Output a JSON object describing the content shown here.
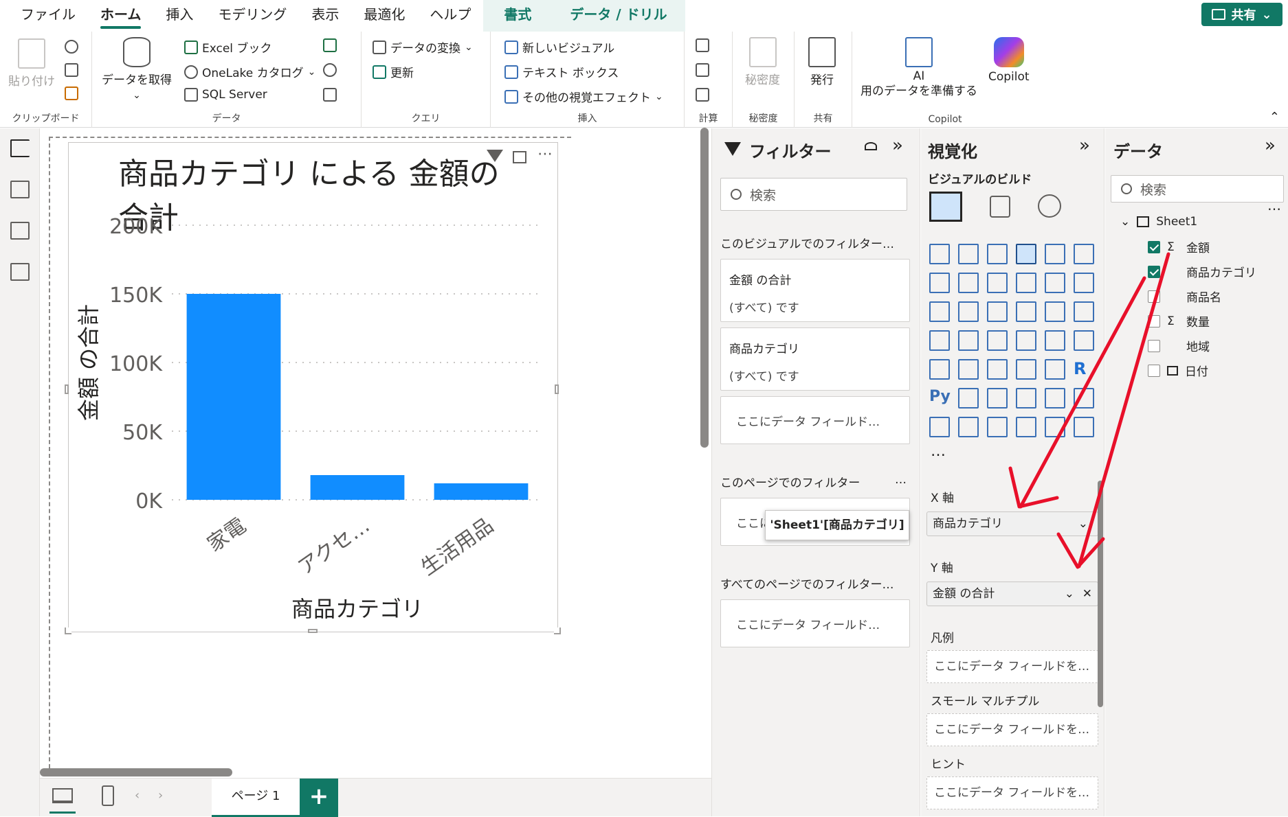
{
  "menubar": {
    "tabs": [
      "ファイル",
      "ホーム",
      "挿入",
      "モデリング",
      "表示",
      "最適化",
      "ヘルプ",
      "書式",
      "データ / ドリル"
    ],
    "active": "ホーム",
    "share": "共有"
  },
  "ribbon": {
    "clipboard": {
      "label": "クリップボード",
      "paste": "貼り付け"
    },
    "data": {
      "label": "データ",
      "get_data": "データを取得",
      "excel": "Excel ブック",
      "onelake": "OneLake カタログ",
      "sql": "SQL Server"
    },
    "query": {
      "label": "クエリ",
      "transform": "データの変換",
      "refresh": "更新"
    },
    "insert": {
      "label": "挿入",
      "new_visual": "新しいビジュアル",
      "text_box": "テキスト ボックス",
      "more_visuals": "その他の視覚エフェクト"
    },
    "calc": {
      "label": "計算"
    },
    "sensitivity": {
      "label": "秘密度",
      "button": "秘密度"
    },
    "share": {
      "label": "共有",
      "publish": "発行"
    },
    "copilot": {
      "label": "Copilot",
      "ai_line1": "AI",
      "ai_line2": "用のデータを準備する",
      "copilot": "Copilot"
    }
  },
  "chart": {
    "title": "商品カテゴリ による 金額の合計"
  },
  "chart_data": {
    "type": "bar",
    "title": "商品カテゴリ による 金額の合計",
    "categories": [
      "家電",
      "アクセ…",
      "生活用品"
    ],
    "values": [
      150000,
      18000,
      12000
    ],
    "xlabel": "商品カテゴリ",
    "ylabel": "金額 の合計",
    "ylim": [
      0,
      200000
    ],
    "yticks": [
      "0K",
      "50K",
      "100K",
      "150K",
      "200K"
    ],
    "grid": true,
    "bar_color": "#118dff"
  },
  "pages": {
    "tab": "ページ 1",
    "add": "+"
  },
  "filters": {
    "title": "フィルター",
    "search": "検索",
    "visual_section": "このビジュアルでのフィルター…",
    "card1": {
      "field": "金額 の合計",
      "value": "(すべて) です"
    },
    "card2": {
      "field": "商品カテゴリ",
      "value": "(すべて) です"
    },
    "drop": "ここにデータ フィールド…",
    "page_section": "このページでのフィルター",
    "page_more": "…",
    "page_drop": "ここに",
    "all_section": "すべてのページでのフィルター…",
    "all_drop": "ここにデータ フィールド…",
    "tooltip": "'Sheet1'[商品カテゴリ]"
  },
  "viz": {
    "title": "視覚化",
    "build": "ビジュアルのビルド",
    "more": "…",
    "py": "Py",
    "r": "R",
    "x_axis": "X 軸",
    "x_field": "商品カテゴリ",
    "y_axis": "Y 軸",
    "y_field": "金額 の合計",
    "legend": "凡例",
    "small_multiples": "スモール マルチプル",
    "tooltips": "ヒント",
    "drop": "ここにデータ フィールドを…"
  },
  "data": {
    "title": "データ",
    "search": "検索",
    "table": "Sheet1",
    "fields": [
      {
        "name": "金額",
        "checked": true,
        "sigma": true
      },
      {
        "name": "商品カテゴリ",
        "checked": true,
        "sigma": false
      },
      {
        "name": "商品名",
        "checked": false,
        "sigma": false
      },
      {
        "name": "数量",
        "checked": false,
        "sigma": true
      },
      {
        "name": "地域",
        "checked": false,
        "sigma": false
      },
      {
        "name": "日付",
        "checked": false,
        "sigma": false
      }
    ],
    "sigma_symbol": "Σ",
    "more": "…"
  },
  "colors": {
    "accent": "#117865",
    "bar": "#118dff",
    "arrow": "#e8102a"
  }
}
